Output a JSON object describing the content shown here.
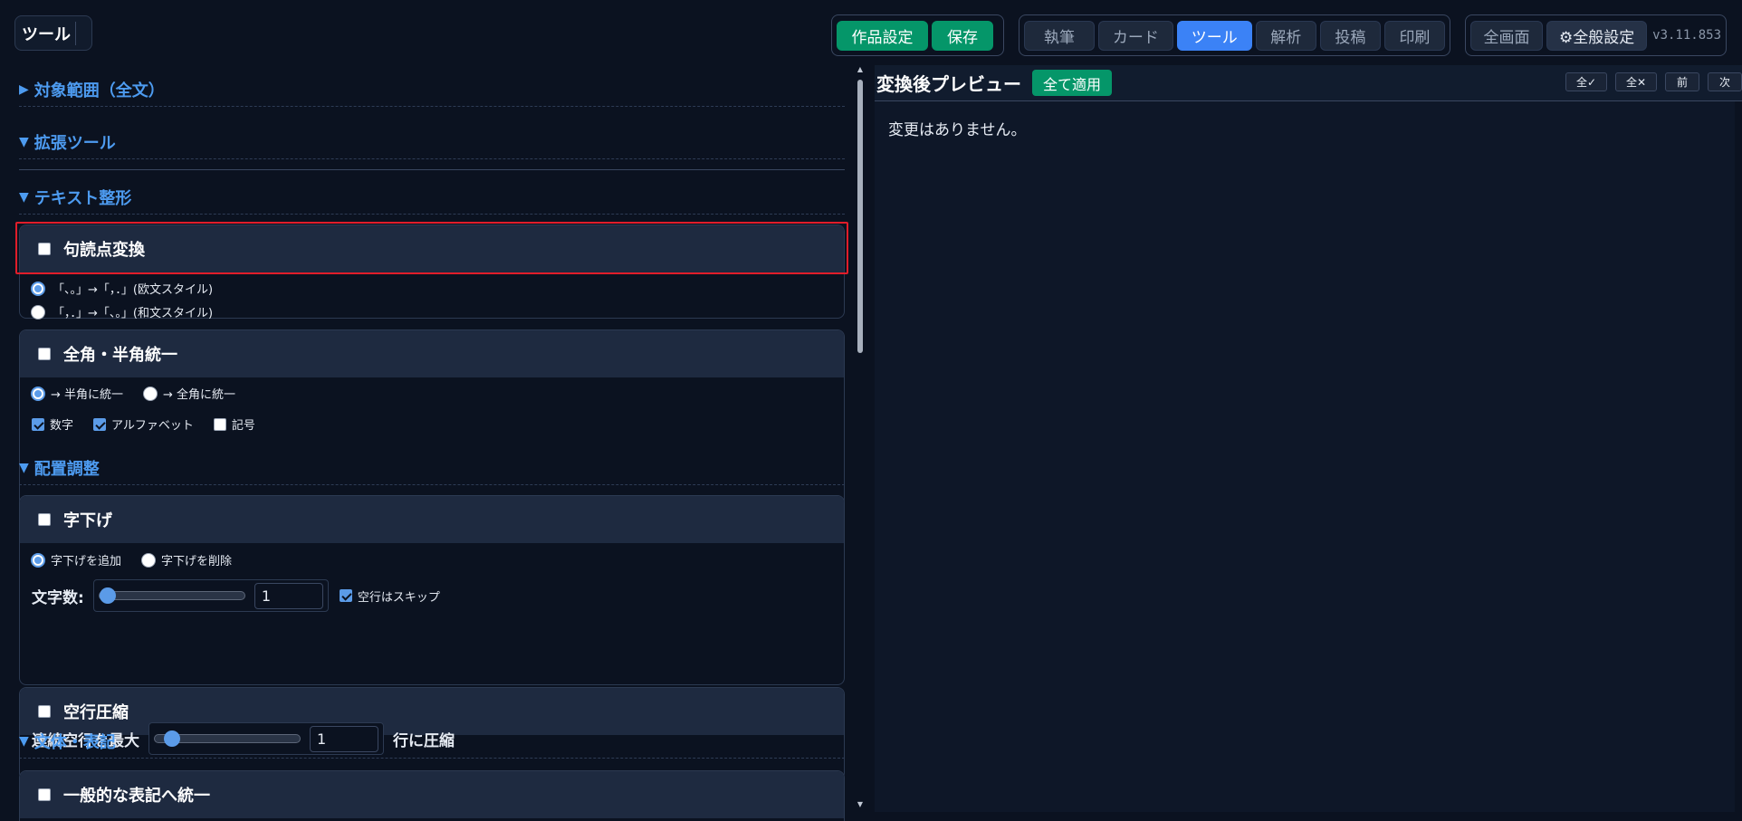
{
  "header": {
    "tool_title": "ツール",
    "project_settings": "作品設定",
    "save": "保存",
    "tabs": [
      "執筆",
      "カード",
      "ツール",
      "解析",
      "投稿",
      "印刷"
    ],
    "active_tab": "ツール",
    "fullscreen": "全画面",
    "general_settings": "⚙全般設定",
    "version": "v3.11.853"
  },
  "left": {
    "scope_section": "対象範囲（全文）",
    "ext_tools_section": "拡張ツール",
    "text_format_section": "テキスト整形",
    "punct": {
      "title": "句読点変換",
      "checked": false,
      "options": [
        "「、。」→「，．」(欧文スタイル)",
        "「，．」→「、。」(和文スタイル)"
      ],
      "selected": 0
    },
    "width": {
      "title": "全角・半角統一",
      "checked": false,
      "options": [
        "→ 半角に統一",
        "→ 全角に統一"
      ],
      "selected": 0,
      "targets": [
        {
          "label": "数字",
          "checked": true
        },
        {
          "label": "アルファベット",
          "checked": true
        },
        {
          "label": "記号",
          "checked": false
        }
      ]
    },
    "layout_section": "配置調整",
    "indent": {
      "title": "字下げ",
      "checked": false,
      "options": [
        "字下げを追加",
        "字下げを削除"
      ],
      "selected": 0,
      "count_label": "文字数:",
      "count_value": "1",
      "slider_level": 0.0,
      "skip_label": "空行はスキップ",
      "skip_checked": true
    },
    "blank": {
      "title": "空行圧縮",
      "checked": false,
      "prefix_label": "連続空行を最大",
      "value": "1",
      "slider_level": 0.1,
      "suffix_label": "行に圧縮"
    },
    "style_section": "文体・表記",
    "unify": {
      "title": "一般的な表記へ統一",
      "checked": false
    }
  },
  "preview": {
    "title": "変換後プレビュー",
    "apply_all": "全て適用",
    "check_all": "全✓",
    "uncheck_all": "全✕",
    "prev": "前",
    "next": "次",
    "empty_message": "変更はありません。"
  }
}
